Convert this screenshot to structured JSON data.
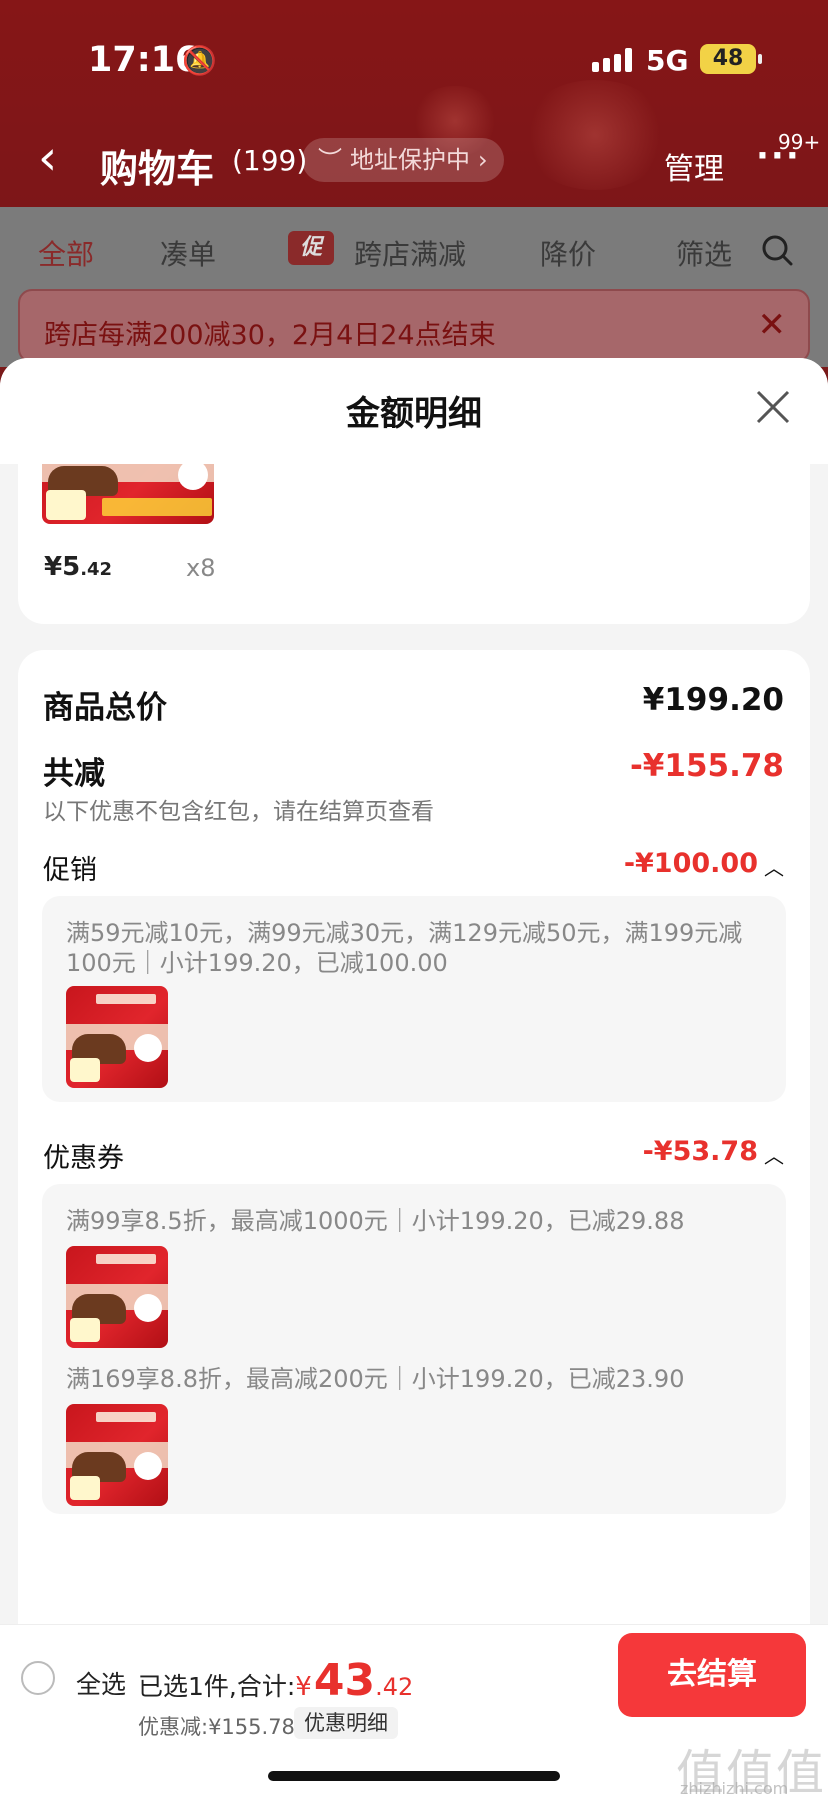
{
  "status": {
    "time": "17:16",
    "network": "5G",
    "battery": "48"
  },
  "nav": {
    "title": "购物车",
    "count": "(199)",
    "address": "地址保护中",
    "manage": "管理",
    "more_badge": "99+"
  },
  "tabs": [
    "全部",
    "凑单",
    "跨店满减",
    "降价",
    "筛选"
  ],
  "promo_tag": "促",
  "promo_bar": "跨店每满200减30，2月4日24点结束",
  "sheet": {
    "title": "金额明细",
    "item": {
      "price_int": "¥5",
      "price_dec": ".42",
      "qty": "x8"
    },
    "goods_total_label": "商品总价",
    "goods_total": "¥199.20",
    "discount_label": "共减",
    "discount_total": "-¥155.78",
    "note": "以下优惠不包含红包，请在结算页查看",
    "promotion": {
      "label": "促销",
      "value": "-¥100.00",
      "rule": "满59元减10元，满99元减30元，满129元减50元，满199元减100元｜小计199.20，已减100.00"
    },
    "coupon": {
      "label": "优惠券",
      "value": "-¥53.78",
      "rules": [
        "满99享8.5折，最高减1000元｜小计199.20，已减29.88",
        "满169享8.8折，最高减200元｜小计199.20，已减23.90"
      ]
    }
  },
  "bottom": {
    "select_all": "全选",
    "selected_info": "已选1件,合计:",
    "total_currency": "¥",
    "total_int": "43",
    "total_dec": ".42",
    "discount_text": "优惠减:¥155.78",
    "detail_button": "优惠明细",
    "checkout": "去结算"
  },
  "watermark": {
    "main": "值值值",
    "sub": "zhizhizhi.com"
  },
  "colors": {
    "accent": "#e8312d",
    "header_red": "#861617",
    "checkout": "#f5383a"
  }
}
